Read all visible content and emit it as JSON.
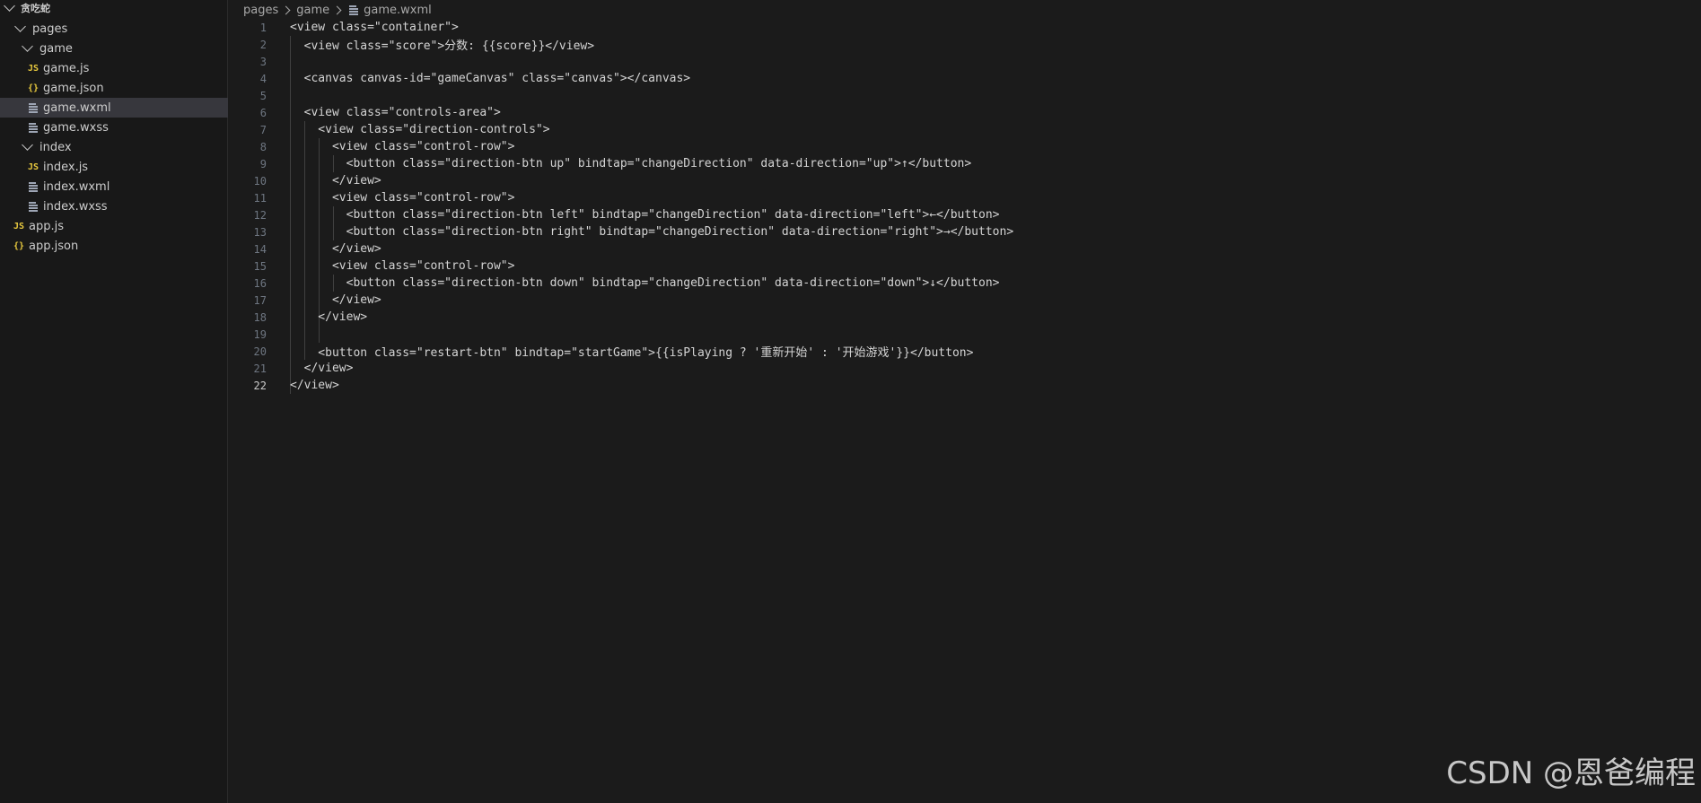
{
  "sidebar": {
    "root": "贪吃蛇",
    "items": [
      {
        "label": "pages",
        "kind": "folder"
      },
      {
        "label": "game",
        "kind": "folder"
      },
      {
        "label": "game.js",
        "kind": "js",
        "icon": "JS"
      },
      {
        "label": "game.json",
        "kind": "json",
        "icon": "{}"
      },
      {
        "label": "game.wxml",
        "kind": "wxml",
        "active": true
      },
      {
        "label": "game.wxss",
        "kind": "wxss"
      },
      {
        "label": "index",
        "kind": "folder"
      },
      {
        "label": "index.js",
        "kind": "js",
        "icon": "JS"
      },
      {
        "label": "index.wxml",
        "kind": "wxml"
      },
      {
        "label": "index.wxss",
        "kind": "wxss"
      },
      {
        "label": "app.js",
        "kind": "js",
        "icon": "JS"
      },
      {
        "label": "app.json",
        "kind": "json",
        "icon": "{}"
      }
    ]
  },
  "breadcrumb": {
    "items": [
      "pages",
      "game",
      "game.wxml"
    ]
  },
  "editor": {
    "active_line": 22,
    "lines": [
      {
        "n": "1",
        "text": "<view class=\"container\">"
      },
      {
        "n": "2",
        "text": "  <view class=\"score\">分数: {{score}}</view>"
      },
      {
        "n": "3",
        "text": ""
      },
      {
        "n": "4",
        "text": "  <canvas canvas-id=\"gameCanvas\" class=\"canvas\"></canvas>"
      },
      {
        "n": "5",
        "text": ""
      },
      {
        "n": "6",
        "text": "  <view class=\"controls-area\">"
      },
      {
        "n": "7",
        "text": "    <view class=\"direction-controls\">"
      },
      {
        "n": "8",
        "text": "      <view class=\"control-row\">"
      },
      {
        "n": "9",
        "text": "        <button class=\"direction-btn up\" bindtap=\"changeDirection\" data-direction=\"up\">↑</button>"
      },
      {
        "n": "10",
        "text": "      </view>"
      },
      {
        "n": "11",
        "text": "      <view class=\"control-row\">"
      },
      {
        "n": "12",
        "text": "        <button class=\"direction-btn left\" bindtap=\"changeDirection\" data-direction=\"left\">←</button>"
      },
      {
        "n": "13",
        "text": "        <button class=\"direction-btn right\" bindtap=\"changeDirection\" data-direction=\"right\">→</button>"
      },
      {
        "n": "14",
        "text": "      </view>"
      },
      {
        "n": "15",
        "text": "      <view class=\"control-row\">"
      },
      {
        "n": "16",
        "text": "        <button class=\"direction-btn down\" bindtap=\"changeDirection\" data-direction=\"down\">↓</button>"
      },
      {
        "n": "17",
        "text": "      </view>"
      },
      {
        "n": "18",
        "text": "    </view>"
      },
      {
        "n": "19",
        "text": ""
      },
      {
        "n": "20",
        "text": "    <button class=\"restart-btn\" bindtap=\"startGame\">{{isPlaying ? '重新开始' : '开始游戏'}}</button>"
      },
      {
        "n": "21",
        "text": "  </view>"
      },
      {
        "n": "22",
        "text": "</view>"
      }
    ]
  },
  "watermark": "CSDN @恩爸编程",
  "colors": {
    "background": "#1b1b1b",
    "sidebar": "#181818",
    "active_row": "#37373d",
    "js_icon": "#e8c93e",
    "text": "#d4d4d4"
  }
}
